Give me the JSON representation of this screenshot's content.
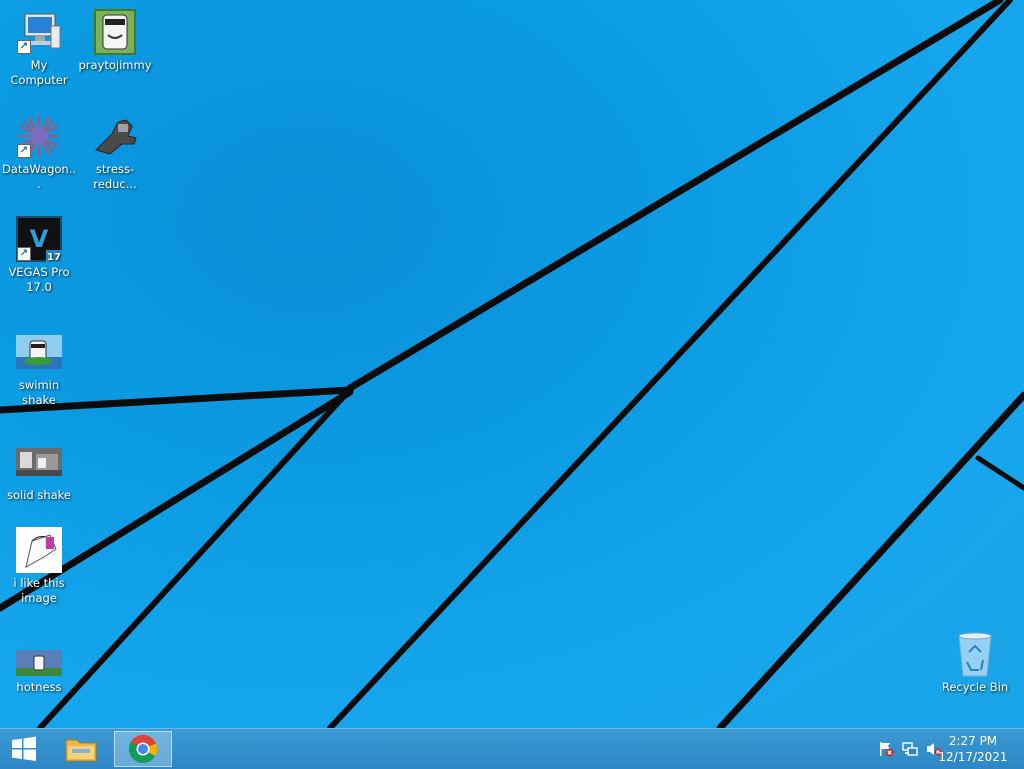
{
  "desktop": {
    "icons": [
      {
        "id": "my-computer",
        "label": "My Computer"
      },
      {
        "id": "praytojimmy",
        "label": "praytojimmy"
      },
      {
        "id": "datawagon",
        "label": "DataWagon..."
      },
      {
        "id": "stress-reducer",
        "label": "stress-reduc..."
      },
      {
        "id": "vegas-pro",
        "label": "VEGAS Pro 17.0",
        "badge": "17",
        "letter": "V"
      },
      {
        "id": "swimin-shake",
        "label": "swimin shake"
      },
      {
        "id": "solid-shake",
        "label": "solid shake"
      },
      {
        "id": "i-like-this-image",
        "label": "i like this image"
      },
      {
        "id": "hotness",
        "label": "hotness"
      },
      {
        "id": "recycle-bin",
        "label": "Recycle Bin"
      }
    ]
  },
  "taskbar": {
    "start_icon": "windows-logo-icon",
    "pinned": [
      {
        "name": "file-explorer",
        "icon": "folder-icon"
      },
      {
        "name": "google-chrome",
        "icon": "chrome-icon",
        "active": true
      }
    ],
    "tray": {
      "icons": [
        "action-center-flag-icon",
        "network-icon",
        "volume-muted-icon"
      ],
      "time": "2:27 PM",
      "date": "12/17/2021"
    }
  },
  "colors": {
    "wallpaper_blue": "#0b9be3",
    "taskbar": "#2e86c4",
    "wallpaper_lines": "#0a0a0a"
  }
}
